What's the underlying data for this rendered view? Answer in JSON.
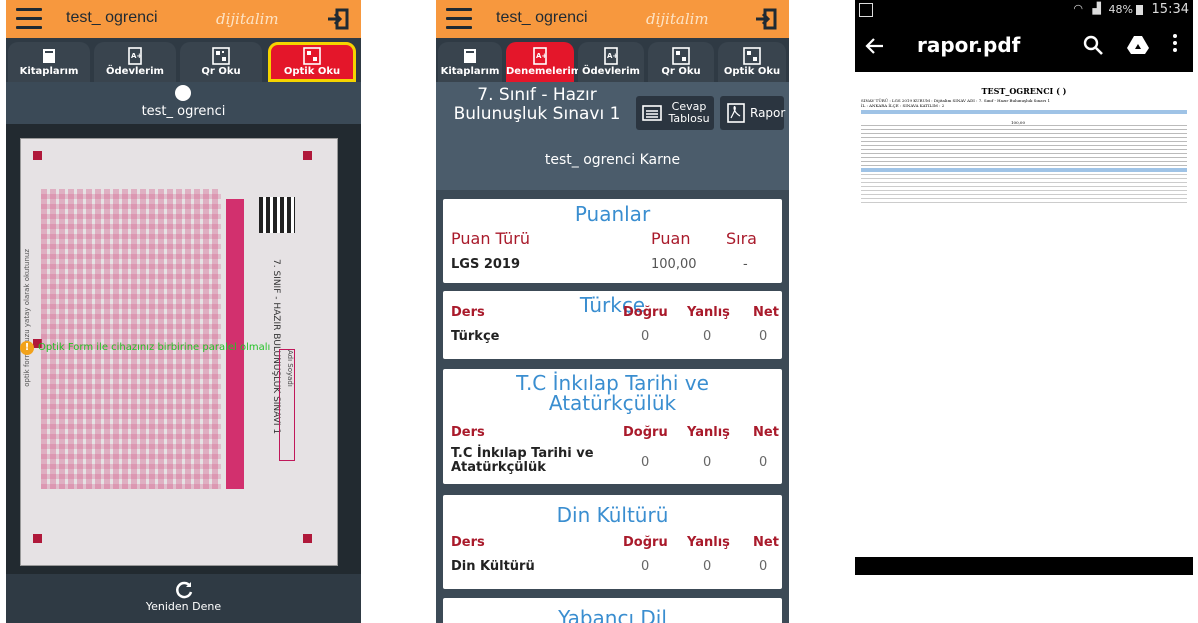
{
  "user": "test_ ogrenci",
  "brand": "dijitalim",
  "phone1": {
    "tabs": [
      {
        "label": "Kitaplarım",
        "icon": "book-icon"
      },
      {
        "label": "Ödevlerim",
        "icon": "homework-icon"
      },
      {
        "label": "Qr Oku",
        "icon": "qr-icon"
      },
      {
        "label": "Optik Oku",
        "icon": "optic-icon",
        "active": true
      }
    ],
    "profile_name": "test_ ogrenci",
    "warning": "Optik Form ile cihazınız birbirine paralel olmalı",
    "form_side_text": "7. SINIF - HAZIR BULUNUŞLUK SINAVI 1",
    "form_name_label": "Adı Soyadı",
    "form_left_text": "optik formunuzu yatay olarak okutunuz",
    "retry_label": "Yeniden Dene"
  },
  "phone2": {
    "tabs": [
      {
        "label": "Kitaplarım",
        "icon": "book-icon"
      },
      {
        "label": "Denemelerim",
        "icon": "exam-icon",
        "active": true
      },
      {
        "label": "Ödevlerim",
        "icon": "homework-icon"
      },
      {
        "label": "Qr Oku",
        "icon": "qr-icon"
      },
      {
        "label": "Optik Oku",
        "icon": "optic-icon"
      }
    ],
    "exam_title": "7. Sınıf - Hazır Bulunuşluk Sınavı 1",
    "cevap_label": "Cevap Tablosu",
    "rapor_label": "Rapor",
    "karne_title": "test_ ogrenci Karne",
    "puanlar": {
      "title": "Puanlar",
      "headers": [
        "Puan Türü",
        "Puan",
        "Sıra"
      ],
      "row": [
        "LGS 2019",
        "100,00",
        "-"
      ]
    },
    "subject_headers": [
      "Ders",
      "Doğru",
      "Yanlış",
      "Net"
    ],
    "subjects": [
      {
        "title": "Türkçe",
        "name": "Türkçe",
        "dogru": "0",
        "yanlis": "0",
        "net": "0"
      },
      {
        "title": "T.C İnkılap Tarihi ve Atatürkçülük",
        "name": "T.C İnkılap Tarihi ve Atatürkçülük",
        "dogru": "0",
        "yanlis": "0",
        "net": "0"
      },
      {
        "title": "Din Kültürü",
        "name": "Din Kültürü",
        "dogru": "0",
        "yanlis": "0",
        "net": "0"
      },
      {
        "title": "Yabancı Dil"
      }
    ]
  },
  "phone3": {
    "status_battery": "48%",
    "status_time": "15:34",
    "file_title": "rapor.pdf",
    "doc_title": "TEST_OGRENCI ( )",
    "doc_line1": "SINAV TÜRÜ : LGS 2019    KURUM : Dijitalim    SINAV ADI : 7. Sınıf - Hazır Bulunuşluk Sınavı 1",
    "doc_line2": "İL : ANKARA    İLÇE :    SINAVA KATILIM : 2",
    "doc_score": "100,00"
  }
}
